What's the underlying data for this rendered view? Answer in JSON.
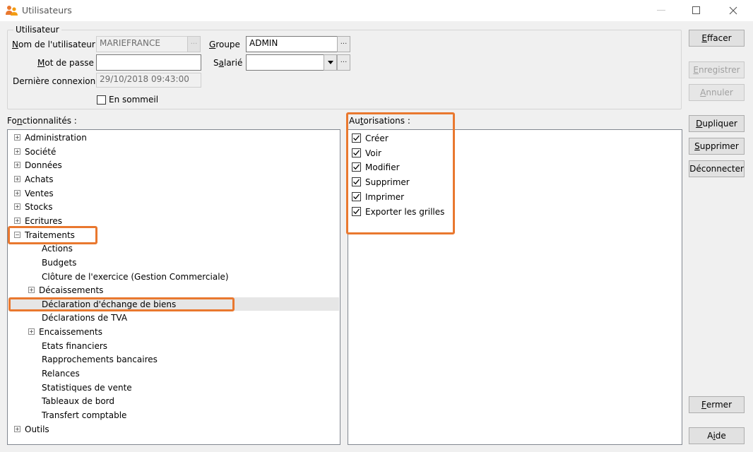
{
  "window": {
    "title": "Utilisateurs",
    "controls": [
      "—",
      "☐",
      "✕"
    ]
  },
  "user_group": {
    "legend": "Utilisateur",
    "username_label_u": "N",
    "username_label_rest": "om de l'utilisateur",
    "username_value": "MARIEFRANCE",
    "password_label_u": "M",
    "password_label_rest": "ot de passe",
    "password_value": "",
    "group_label_u": "G",
    "group_label_rest": "roupe",
    "group_value": "ADMIN",
    "employee_label_pre": "S",
    "employee_label_u": "a",
    "employee_label_rest": "larié",
    "employee_value": "",
    "last_login_label": "Dernière connexion",
    "last_login_value": "29/10/2018 09:43:00",
    "sleep_label": "En sommeil",
    "sleep_checked": false,
    "ellipsis": "···"
  },
  "features": {
    "label_pre": "Fo",
    "label_u": "n",
    "label_rest": "ctionnalités :",
    "items": [
      {
        "label": "Administration",
        "expander": "+"
      },
      {
        "label": "Société",
        "expander": "+"
      },
      {
        "label": "Données",
        "expander": "+"
      },
      {
        "label": "Achats",
        "expander": "+"
      },
      {
        "label": "Ventes",
        "expander": "+"
      },
      {
        "label": "Stocks",
        "expander": "+"
      },
      {
        "label": "Ecritures",
        "expander": "+"
      },
      {
        "label": "Traitements",
        "expander": "−"
      },
      {
        "label": "Actions",
        "expander": ""
      },
      {
        "label": "Budgets",
        "expander": ""
      },
      {
        "label": "Clôture de l'exercice (Gestion Commerciale)",
        "expander": ""
      },
      {
        "label": "Décaissements",
        "expander": "+"
      },
      {
        "label": "Déclaration d'échange de biens",
        "expander": ""
      },
      {
        "label": "Déclarations de TVA",
        "expander": ""
      },
      {
        "label": "Encaissements",
        "expander": "+"
      },
      {
        "label": "Etats financiers",
        "expander": ""
      },
      {
        "label": "Rapprochements bancaires",
        "expander": ""
      },
      {
        "label": "Relances",
        "expander": ""
      },
      {
        "label": "Statistiques de vente",
        "expander": ""
      },
      {
        "label": "Tableaux de bord",
        "expander": ""
      },
      {
        "label": "Transfert comptable",
        "expander": ""
      },
      {
        "label": "Outils",
        "expander": "+"
      }
    ]
  },
  "authorizations": {
    "label_pre": "Au",
    "label_u": "t",
    "label_rest": "orisations :",
    "items": [
      {
        "label": "Créer",
        "checked": true
      },
      {
        "label": "Voir",
        "checked": true
      },
      {
        "label": "Modifier",
        "checked": true
      },
      {
        "label": "Supprimer",
        "checked": true
      },
      {
        "label": "Imprimer",
        "checked": true
      },
      {
        "label": "Exporter les grilles",
        "checked": true
      }
    ]
  },
  "buttons": {
    "effacer_u": "E",
    "effacer_rest": "ffacer",
    "enregistrer_u": "E",
    "enregistrer_rest": "nregistrer",
    "annuler_u": "A",
    "annuler_rest": "nnuler",
    "dupliquer_u": "D",
    "dupliquer_rest": "upliquer",
    "supprimer_u": "S",
    "supprimer_rest": "upprimer",
    "deconnecter": "Déconnecter",
    "fermer_u": "F",
    "fermer_rest": "ermer",
    "aide_pre": "A",
    "aide_u": "i",
    "aide_rest": "de"
  },
  "colors": {
    "highlight": "#e9782f",
    "window_bg": "#f0f0f0",
    "selected_row": "#e6e6e6"
  }
}
